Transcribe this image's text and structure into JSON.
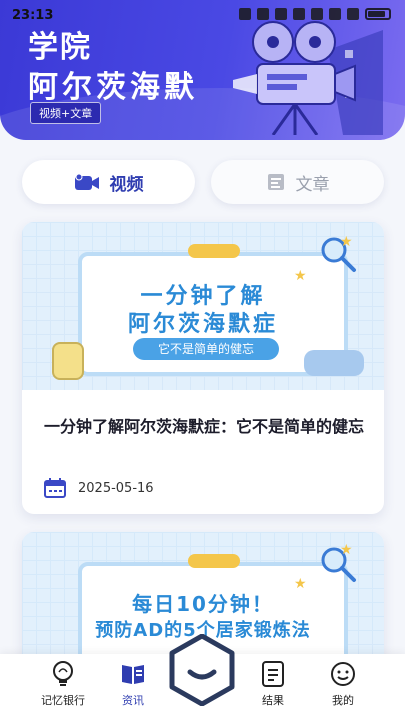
{
  "status": {
    "time": "23:13"
  },
  "header": {
    "title_line1": "学院",
    "title_line2": "阿尔茨海默",
    "tag": "视频+文章"
  },
  "tabs": [
    {
      "label": "视频",
      "active": true,
      "icon": "video-camera-icon"
    },
    {
      "label": "文章",
      "active": false,
      "icon": "article-icon"
    }
  ],
  "cards": [
    {
      "thumb_line1": "一分钟了解",
      "thumb_line2": "阿尔茨海默症",
      "thumb_pill": "它不是简单的健忘",
      "title": "一分钟了解阿尔茨海默症：它不是简单的健忘",
      "date": "2025-05-16"
    },
    {
      "thumb_line1": "每日10分钟！",
      "thumb_line2": "预防AD的5个居家锻炼法"
    }
  ],
  "nav": {
    "items": [
      {
        "label": "记忆银行",
        "icon": "lightbulb-icon",
        "active": false
      },
      {
        "label": "资讯",
        "icon": "book-icon",
        "active": true
      },
      {
        "label": "结果",
        "icon": "document-icon",
        "active": false
      },
      {
        "label": "我的",
        "icon": "smile-icon",
        "active": false
      }
    ],
    "center_icon": "home-hexagon-icon"
  },
  "colors": {
    "brand": "#3b39d6",
    "accent": "#2f3db0",
    "thumb_text": "#2a8ad6"
  }
}
